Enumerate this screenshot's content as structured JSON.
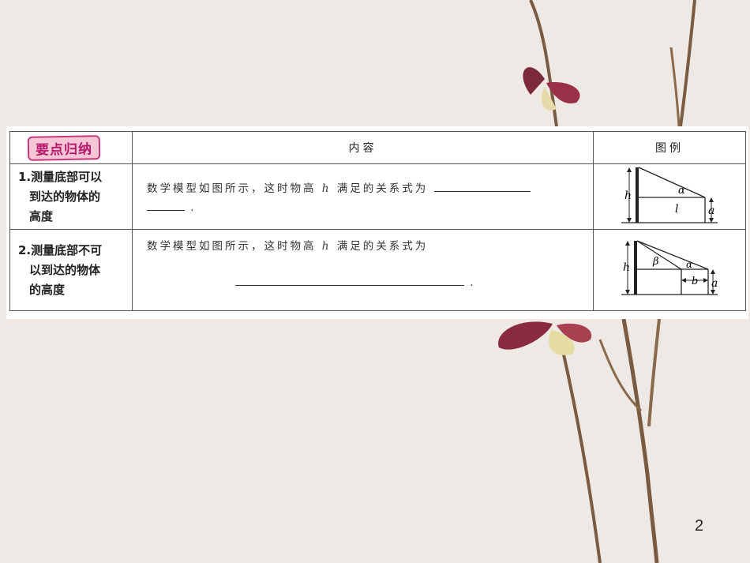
{
  "badge": "要点归纳",
  "header": {
    "content": "内容",
    "figure": "图例"
  },
  "rows": [
    {
      "item_lines": [
        "1.测量底部可以",
        "到达的物体的",
        "高度"
      ],
      "text_before": "数学模型如图所示，这时物高",
      "var": "h",
      "text_after": "满足的关系式为",
      "end": ".",
      "fig_labels": {
        "h": "h",
        "alpha": "α",
        "l": "l",
        "a": "a"
      }
    },
    {
      "item_lines": [
        "2.测量底部不可",
        "以到达的物体",
        "的高度"
      ],
      "text_before": "数学模型如图所示，这时物高",
      "var": "h",
      "text_after": "满足的关系式为",
      "end": ".",
      "fig_labels": {
        "h": "h",
        "beta": "β",
        "alpha": "α",
        "b": "b",
        "a": "a"
      }
    }
  ],
  "page_number": "2",
  "colors": {
    "badge_border": "#c8377a",
    "badge_fill": "#f4c6d6",
    "background": "#efe9e6"
  }
}
